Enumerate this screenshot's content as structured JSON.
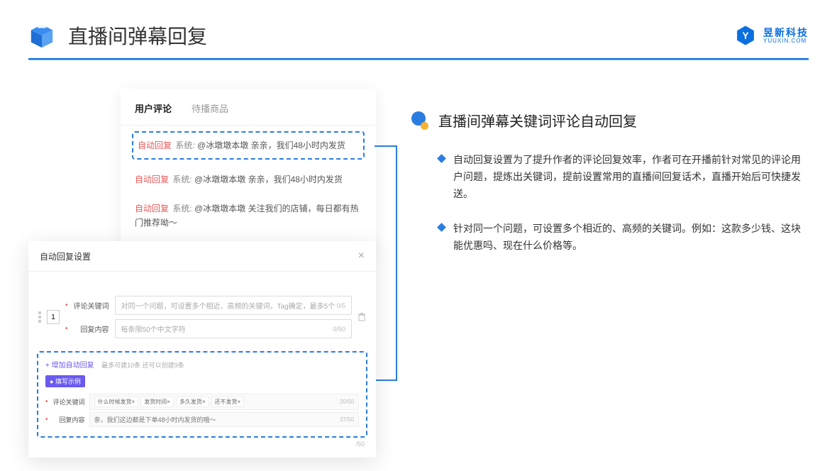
{
  "header": {
    "title": "直播间弹幕回复",
    "brand_name": "昱新科技",
    "brand_url": "YUUXIN.COM"
  },
  "comments_card": {
    "tab_active": "用户评论",
    "tab_inactive": "待播商品",
    "items": [
      {
        "tag": "自动回复",
        "sys": "系统:",
        "text": "@冰墩墩本墩 亲亲，我们48小时内发货"
      },
      {
        "tag": "自动回复",
        "sys": "系统:",
        "text": "@冰墩墩本墩 亲亲，我们48小时内发货"
      },
      {
        "tag": "自动回复",
        "sys": "系统:",
        "text": "@冰墩墩本墩 关注我们的店铺，每日都有热门推荐呦～"
      }
    ]
  },
  "dialog": {
    "title": "自动回复设置",
    "index": "1",
    "keyword_label": "评论关键词",
    "keyword_placeholder": "对同一个问题，可设置多个相近、高频的关键词，Tag确定，最多5个",
    "keyword_count": "0/5",
    "content_label": "回复内容",
    "content_placeholder": "每条限50个中文字符",
    "content_count": "0/50",
    "add_link": "+ 增加自动回复",
    "add_note": "最多可建10条 还可以创建9条",
    "example_badge": "● 填写示例",
    "ex_keyword_label": "评论关键词",
    "ex_tags": [
      "什么时候发货×",
      "发货时间×",
      "多久发货×",
      "还不发货×"
    ],
    "ex_keyword_count": "20/50",
    "ex_content_label": "回复内容",
    "ex_content_text": "亲，我们这边都是下单48小时内发货的哦～",
    "ex_content_count": "37/50",
    "bottom_count": "/50"
  },
  "right": {
    "section_title": "直播间弹幕关键词评论自动回复",
    "bullets": [
      "自动回复设置为了提升作者的评论回复效率，作者可在开播前针对常见的评论用户问题，提炼出关键词，提前设置常用的直播间回复话术，直播开始后可快捷发送。",
      "针对同一个问题，可设置多个相近的、高频的关键词。例如：这款多少钱、这块能优惠吗、现在什么价格等。"
    ]
  }
}
